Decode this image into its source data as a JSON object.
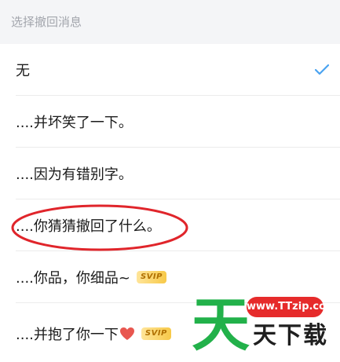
{
  "section": {
    "title": "选择撤回消息"
  },
  "options": [
    {
      "label": "无",
      "selected": true
    },
    {
      "label": "....并坏笑了一下。"
    },
    {
      "label": "....因为有错别字。"
    },
    {
      "label": "....你猜猜撤回了什么。",
      "annotated": true
    },
    {
      "label": "....你品，你细品~",
      "badge": "SVIP"
    },
    {
      "label": "....并抱了你一下",
      "emoji": "heart",
      "badge": "SVIP"
    }
  ],
  "colors": {
    "check": "#4aa3f0",
    "annotation": "#e0252b",
    "badge": "#f7c948",
    "watermark_green": "#22b14a",
    "watermark_red": "#e62b2b"
  },
  "watermark": {
    "badge_text": "www.TTzip.com",
    "big": "天",
    "small": "天下载"
  }
}
